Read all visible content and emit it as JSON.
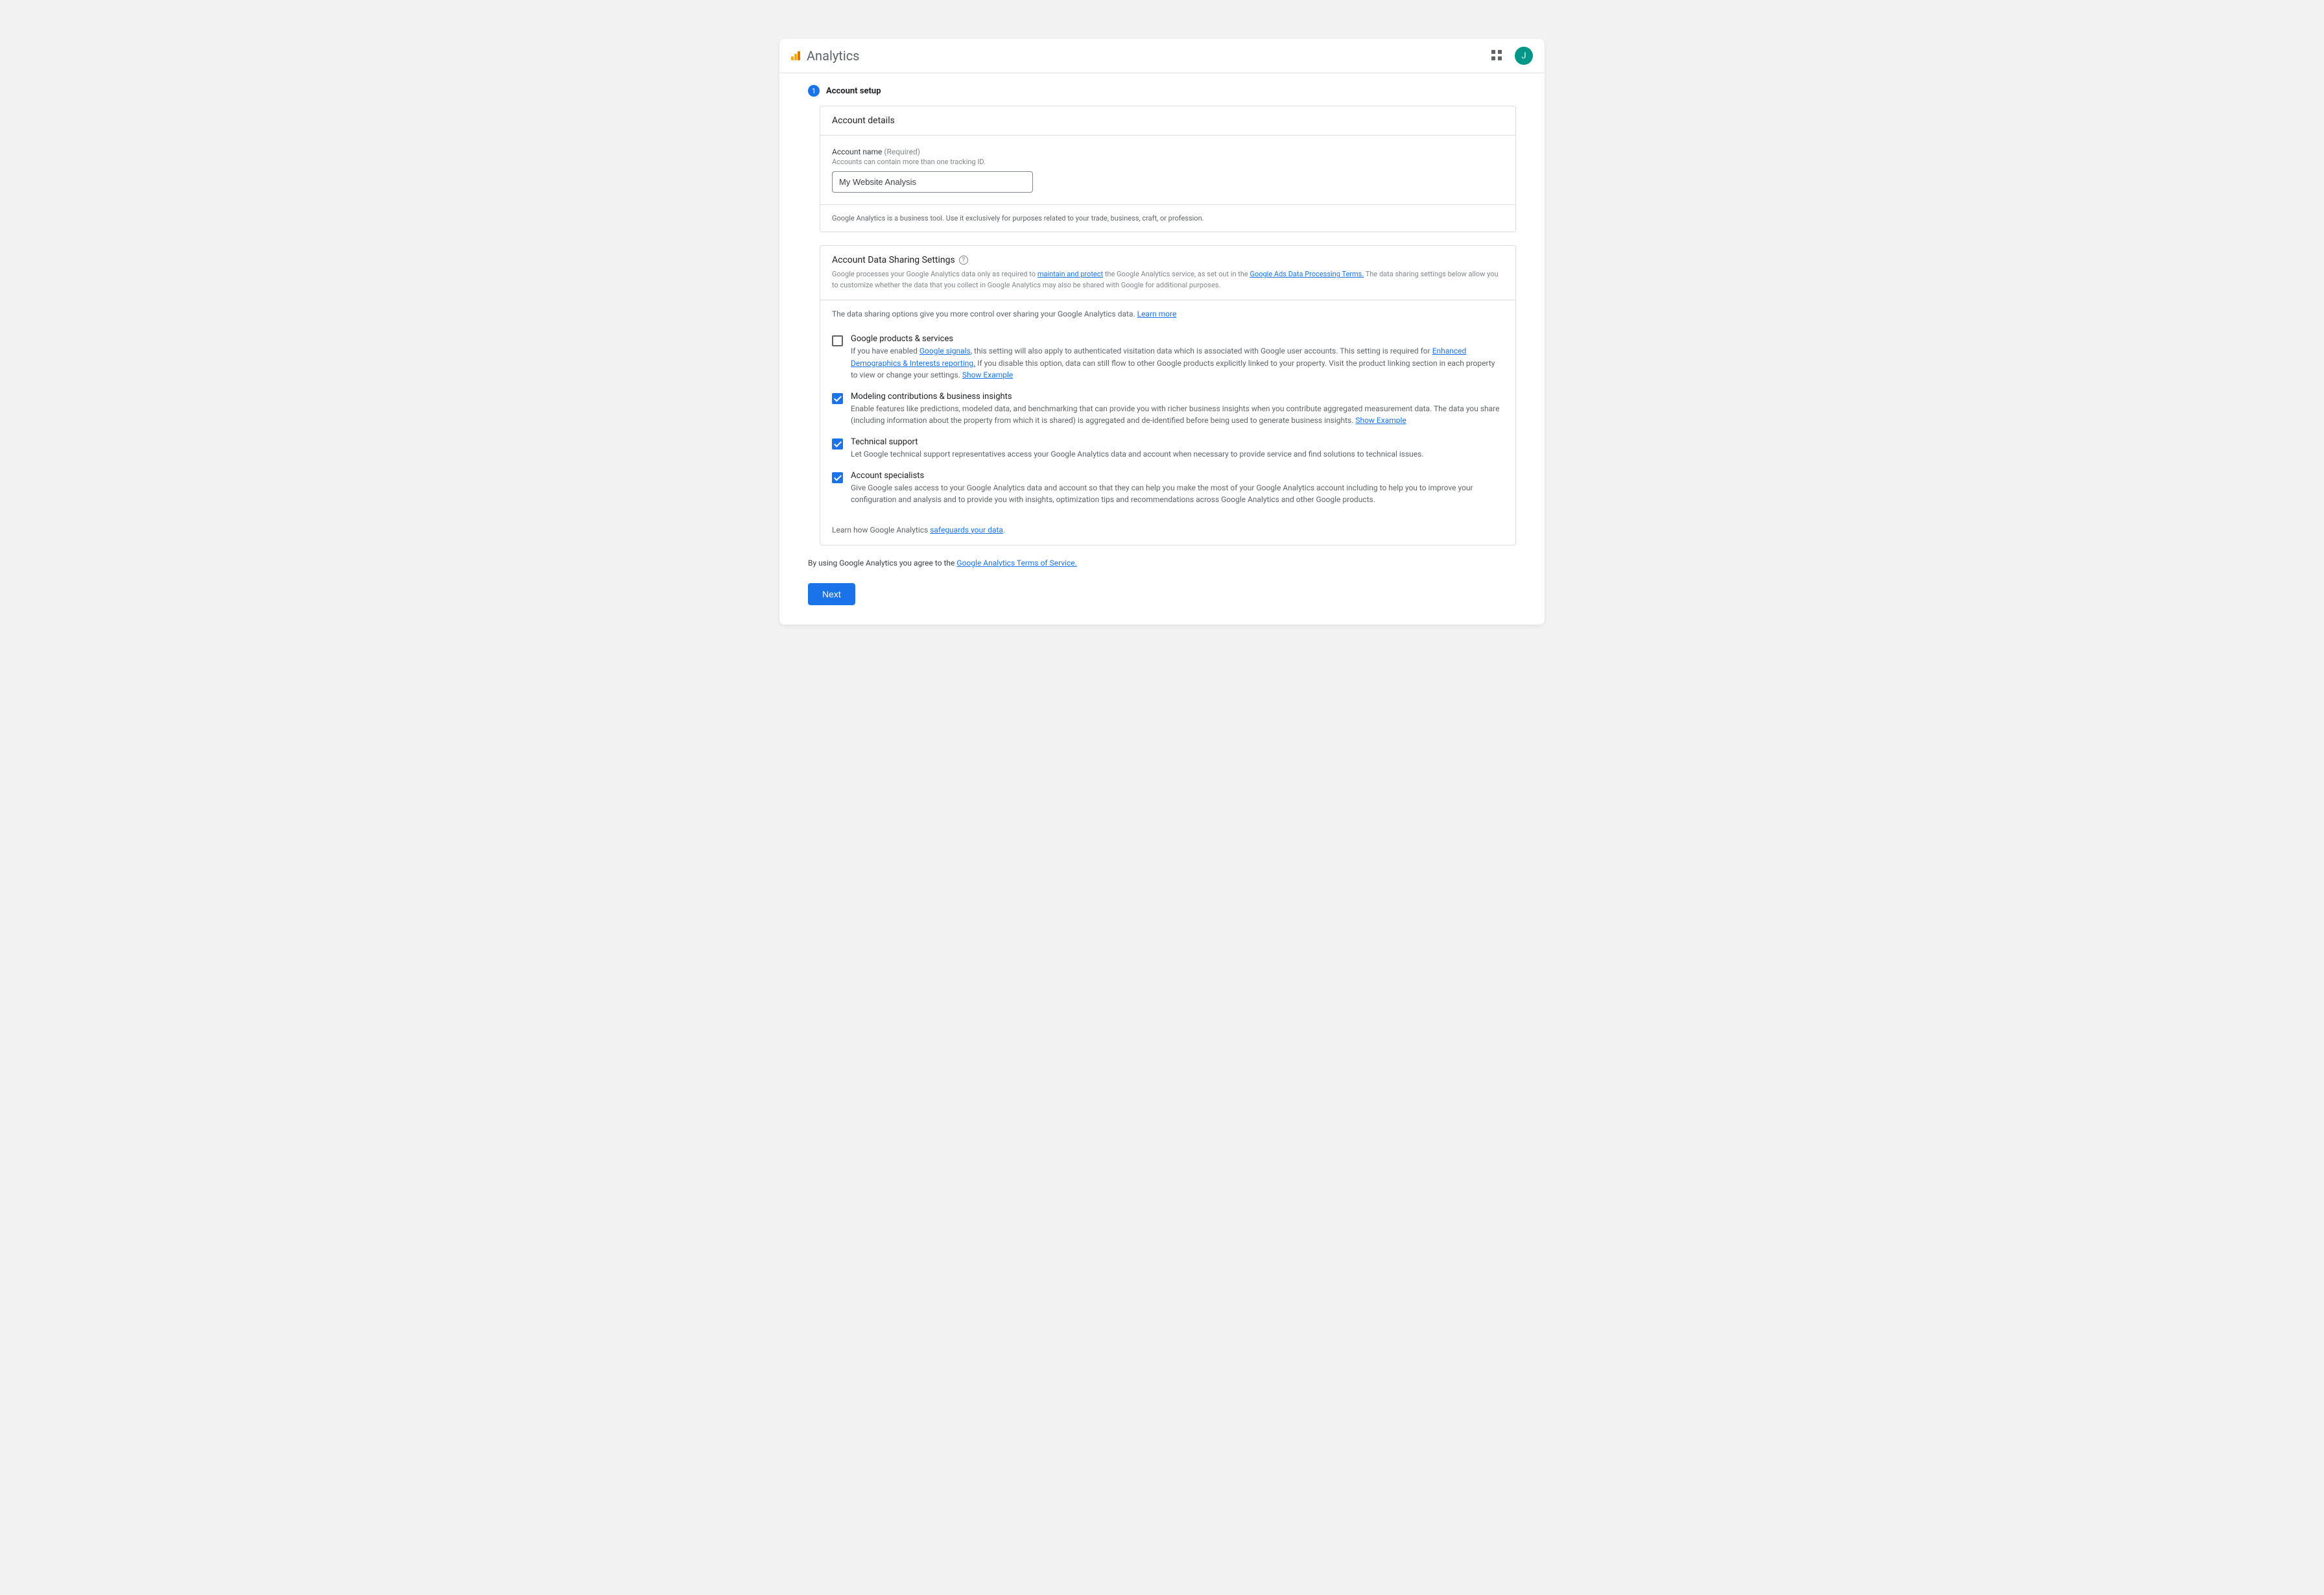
{
  "header": {
    "app_title": "Analytics",
    "avatar_initial": "J"
  },
  "step": {
    "number": "1",
    "label": "Account setup"
  },
  "details_card": {
    "title": "Account details",
    "field_label": "Account name",
    "field_required": "(Required)",
    "hint": "Accounts can contain more than one tracking ID.",
    "value": "My Website Analysis",
    "disclaimer": "Google Analytics is a business tool. Use it exclusively for purposes related to your trade, business, craft, or profession."
  },
  "sharing_card": {
    "title": "Account Data Sharing Settings",
    "desc_prefix": "Google processes your Google Analytics data only as required to ",
    "link1": "maintain and protect",
    "desc_mid": " the Google Analytics service, as set out in the ",
    "link2": "Google Ads Data Processing Terms.",
    "desc_suffix": "  The data sharing settings below allow you to customize whether the data that you collect in Google Analytics may also be shared with Google for additional purposes.",
    "options_lead": "The data sharing options give you more control over sharing your Google Analytics data. ",
    "options_lead_link": "Learn more",
    "items": [
      {
        "checked": false,
        "title": "Google products & services",
        "desc_pre": "If you have enabled ",
        "link_a": "Google signals",
        "desc_mid1": ", this setting will also apply to authenticated visitation data which is associated with Google user accounts. This setting is required for ",
        "link_b": "Enhanced Demographics & Interests reporting.",
        "desc_mid2": "  If you disable this option, data can still flow to other Google products explicitly linked to your property. Visit the product linking section in each property to view or change your settings. ",
        "link_c": "Show Example"
      },
      {
        "checked": true,
        "title": "Modeling contributions & business insights",
        "desc": "Enable features like predictions, modeled data, and benchmarking that can provide you with richer business insights when you contribute aggregated measurement data. The data you share (including information about the property from which it is shared) is aggregated and de-identified before being used to generate business insights. ",
        "link": "Show Example"
      },
      {
        "checked": true,
        "title": "Technical support",
        "desc": "Let Google technical support representatives access your Google Analytics data and account when necessary to provide service and find solutions to technical issues."
      },
      {
        "checked": true,
        "title": "Account specialists",
        "desc": "Give Google sales access to your Google Analytics data and account so that they can help you make the most of your Google Analytics account including to help you to improve your configuration and analysis and to provide you with insights, optimization tips and recommendations across Google Analytics and other Google products."
      }
    ],
    "footnote_pre": "Learn how Google Analytics ",
    "footnote_link": "safeguards your data",
    "footnote_post": "."
  },
  "agree": {
    "pre": "By using Google Analytics you agree to the ",
    "link": "Google Analytics Terms of Service."
  },
  "next_label": "Next"
}
